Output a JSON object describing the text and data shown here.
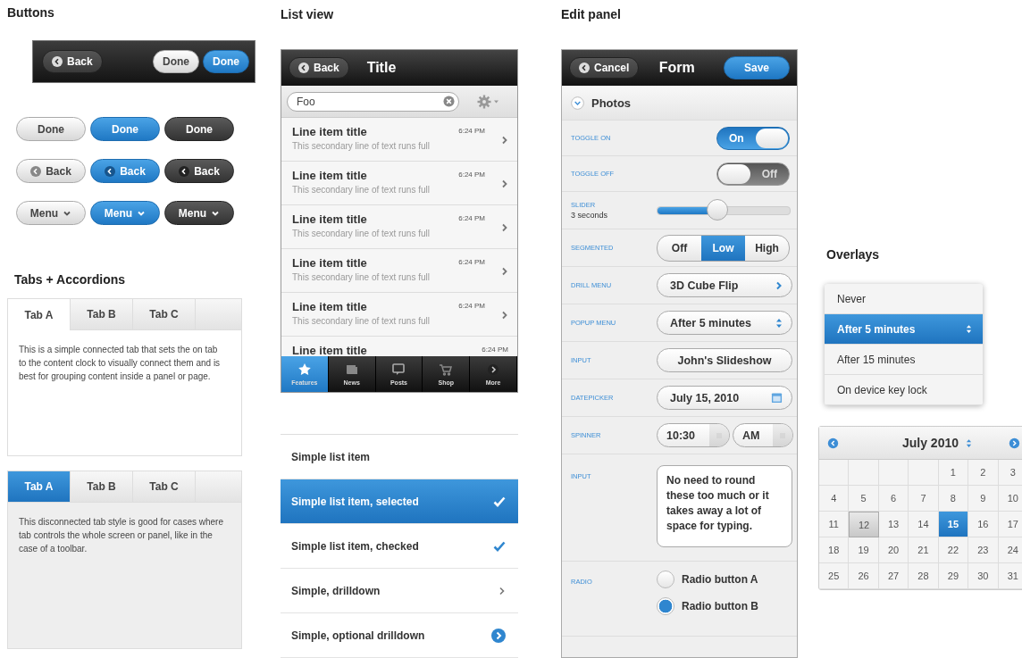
{
  "buttons_section": {
    "heading": "Buttons",
    "toolbar": [
      {
        "label": "Back",
        "kind": "back"
      },
      {
        "label": "Done",
        "kind": "plain"
      },
      {
        "label": "Done",
        "kind": "plain"
      }
    ],
    "button_rows": [
      [
        {
          "label": "Done",
          "kind": "plain"
        },
        {
          "label": "Done",
          "kind": "plain"
        },
        {
          "label": "Done",
          "kind": "plain"
        }
      ],
      [
        {
          "label": "Back",
          "kind": "back"
        },
        {
          "label": "Back",
          "kind": "back"
        },
        {
          "label": "Back",
          "kind": "back"
        }
      ],
      [
        {
          "label": "Menu",
          "kind": "menu"
        },
        {
          "label": "Menu",
          "kind": "menu"
        },
        {
          "label": "Menu",
          "kind": "menu"
        }
      ]
    ]
  },
  "tabs_section": {
    "heading": "Tabs + Accordions",
    "panels": [
      {
        "kind": "connected",
        "tabs": [
          {
            "label": "Tab A",
            "selected": true
          },
          {
            "label": "Tab B",
            "selected": false
          },
          {
            "label": "Tab C",
            "selected": false
          }
        ],
        "text": "This is a simple connected tab that sets the on tab to the content clock to visually connect them and is best for grouping content inside a panel or page."
      },
      {
        "kind": "disconnected",
        "tabs": [
          {
            "label": "Tab A",
            "selected": true
          },
          {
            "label": "Tab B",
            "selected": false
          },
          {
            "label": "Tab C",
            "selected": false
          }
        ],
        "text": "This disconnected tab style is good for cases where tab controls the whole screen or panel, like in the case of a toolbar."
      }
    ]
  },
  "list_view": {
    "heading": "List view",
    "back": "Back",
    "title": "Title",
    "search": {
      "value": "Foo"
    },
    "items": [
      {
        "title": "Line item title",
        "time": "6:24 PM",
        "subtitle": "This secondary line of text runs full"
      },
      {
        "title": "Line item title",
        "time": "6:24 PM",
        "subtitle": "This secondary line of text runs full"
      },
      {
        "title": "Line item title",
        "time": "6:24 PM",
        "subtitle": "This secondary line of text runs full"
      },
      {
        "title": "Line item title",
        "time": "6:24 PM",
        "subtitle": "This secondary line of text runs full"
      },
      {
        "title": "Line item title",
        "time": "6:24 PM",
        "subtitle": "This secondary line of text runs full"
      },
      {
        "title": "Line item title",
        "time": "6:24 PM"
      }
    ],
    "tab_bar": [
      {
        "label": "Features",
        "selected": true
      },
      {
        "label": "News",
        "selected": false
      },
      {
        "label": "Posts",
        "selected": false
      },
      {
        "label": "Shop",
        "selected": false
      },
      {
        "label": "More",
        "selected": false
      }
    ],
    "simple_list": [
      {
        "label": "Simple list item",
        "kind": "plain",
        "selected": false,
        "checked": false
      },
      {
        "label": "Simple list item, selected",
        "kind": "plain",
        "selected": true,
        "checked": true
      },
      {
        "label": "Simple list item, checked",
        "kind": "plain",
        "selected": false,
        "checked": true
      },
      {
        "label": "Simple, drilldown",
        "kind": "drilldown",
        "selected": false,
        "checked": false
      },
      {
        "label": "Simple, optional drilldown",
        "kind": "optional-drilldown",
        "selected": false,
        "checked": false
      }
    ]
  },
  "edit_panel": {
    "heading": "Edit panel",
    "cancel": "Cancel",
    "title": "Form",
    "save": "Save",
    "section": "Photos",
    "rows": [
      {
        "kind": "toggle",
        "label": "TOGGLE ON",
        "on": true,
        "text": "On"
      },
      {
        "kind": "toggle",
        "label": "TOGGLE OFF",
        "on": false,
        "text": "Off"
      },
      {
        "kind": "slider",
        "label": "SLIDER",
        "sublabel": "3 seconds",
        "level": 0.45
      },
      {
        "kind": "segmented",
        "label": "SEGMENTED",
        "options": [
          {
            "label": "Off",
            "selected": false
          },
          {
            "label": "Low",
            "selected": true
          },
          {
            "label": "High",
            "selected": false
          }
        ]
      },
      {
        "kind": "drill",
        "label": "DRILL MENU",
        "value": "3D Cube Flip"
      },
      {
        "kind": "popup",
        "label": "POPUP MENU",
        "value": "After 5 minutes"
      },
      {
        "kind": "input",
        "label": "INPUT",
        "value": "John's Slideshow"
      },
      {
        "kind": "date",
        "label": "DATEPICKER",
        "value": "July 15, 2010"
      },
      {
        "kind": "spinner",
        "label": "SPINNER",
        "values": [
          "10:30",
          "AM"
        ]
      },
      {
        "kind": "textarea",
        "label": "INPUT",
        "value": "No need to round these too much or it takes away a lot of space for typing."
      },
      {
        "kind": "radio",
        "label": "RADIO",
        "options": [
          {
            "label": "Radio button A",
            "selected": false
          },
          {
            "label": "Radio button B",
            "selected": true
          }
        ]
      }
    ]
  },
  "overlays": {
    "heading": "Overlays",
    "menu": [
      {
        "label": "Never",
        "selected": false
      },
      {
        "label": "After 5 minutes",
        "selected": true
      },
      {
        "label": "After 15 minutes",
        "selected": false
      },
      {
        "label": "On device key lock",
        "selected": false
      }
    ],
    "calendar": {
      "title": "July 2010",
      "weeks": [
        [
          {
            "day": "1",
            "selected": false,
            "highlighted": false
          },
          {
            "day": "2",
            "selected": false,
            "highlighted": false
          },
          {
            "day": "3",
            "selected": false,
            "highlighted": false
          }
        ],
        [
          {
            "day": "4",
            "selected": false,
            "highlighted": false
          },
          {
            "day": "5",
            "selected": false,
            "highlighted": false
          },
          {
            "day": "6",
            "selected": false,
            "highlighted": false
          },
          {
            "day": "7",
            "selected": false,
            "highlighted": false
          },
          {
            "day": "8",
            "selected": false,
            "highlighted": false
          },
          {
            "day": "9",
            "selected": false,
            "highlighted": false
          },
          {
            "day": "10",
            "selected": false,
            "highlighted": false
          }
        ],
        [
          {
            "day": "11",
            "selected": false,
            "highlighted": false
          },
          {
            "day": "12",
            "selected": false,
            "highlighted": true
          },
          {
            "day": "13",
            "selected": false,
            "highlighted": false
          },
          {
            "day": "14",
            "selected": false,
            "highlighted": false
          },
          {
            "day": "15",
            "selected": true,
            "highlighted": false
          },
          {
            "day": "16",
            "selected": false,
            "highlighted": false
          },
          {
            "day": "17",
            "selected": false,
            "highlighted": false
          }
        ],
        [
          {
            "day": "18",
            "selected": false,
            "highlighted": false
          },
          {
            "day": "19",
            "selected": false,
            "highlighted": false
          },
          {
            "day": "20",
            "selected": false,
            "highlighted": false
          },
          {
            "day": "21",
            "selected": false,
            "highlighted": false
          },
          {
            "day": "22",
            "selected": false,
            "highlighted": false
          },
          {
            "day": "23",
            "selected": false,
            "highlighted": false
          },
          {
            "day": "24",
            "selected": false,
            "highlighted": false
          }
        ],
        [
          {
            "day": "25",
            "selected": false,
            "highlighted": false
          },
          {
            "day": "26",
            "selected": false,
            "highlighted": false
          },
          {
            "day": "27",
            "selected": false,
            "highlighted": false
          },
          {
            "day": "28",
            "selected": false,
            "highlighted": false
          },
          {
            "day": "29",
            "selected": false,
            "highlighted": false
          },
          {
            "day": "30",
            "selected": false,
            "highlighted": false
          },
          {
            "day": "31",
            "selected": false,
            "highlighted": false
          }
        ]
      ]
    }
  }
}
